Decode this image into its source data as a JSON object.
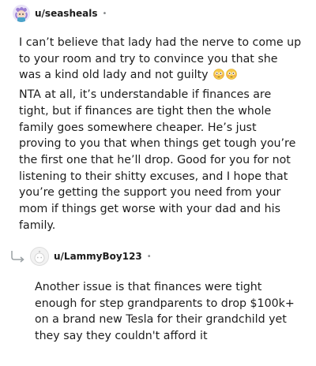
{
  "comment1": {
    "username": "u/seasheals",
    "separator": "•",
    "avatar": "snoo-avatar-purple",
    "paragraphs": [
      "I can’t believe that lady had the nerve to come up to your room and try to convince you that she was a kind old lady and not guilty",
      "NTA at all, it’s understandable if finances are tight, but if finances are tight then the whole family goes somewhere cheaper. He’s just proving to you that when things get tough you’re the first one that he’ll drop. Good for you for not listening to their shitty excuses, and I hope that you’re getting the support you need from your mom if things get worse with your dad and his family."
    ],
    "emoji": "flushed-face-emoji"
  },
  "comment2": {
    "username": "u/LammyBoy123",
    "separator": "•",
    "avatar": "default-avatar-grey",
    "reply_icon": "reply-arrow-icon",
    "paragraphs": [
      "Another issue is that finances were tight enough for step grandparents to drop $100k+ on a brand new Tesla for their grandchild yet they say they couldn't afford it"
    ]
  }
}
